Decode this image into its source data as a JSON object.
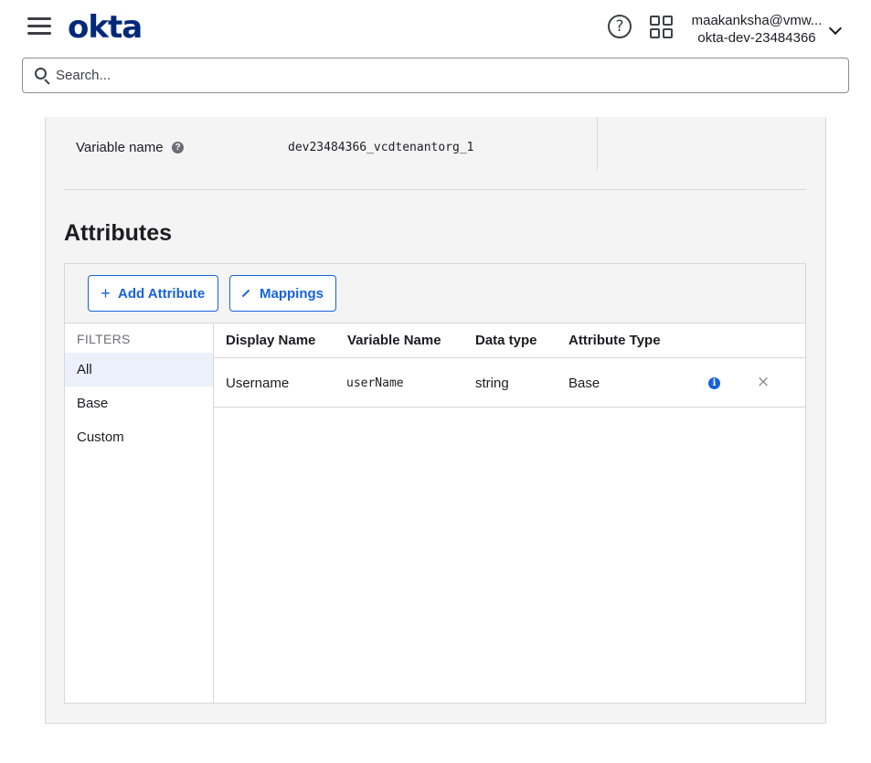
{
  "header": {
    "logo_text": "okta",
    "help_icon": "?",
    "user_email": "maakanksha@vmw...",
    "user_org": "okta-dev-23484366"
  },
  "search": {
    "placeholder": "Search..."
  },
  "variable": {
    "label": "Variable name",
    "help_icon": "?",
    "value": "dev23484366_vcdtenantorg_1"
  },
  "attributes": {
    "title": "Attributes",
    "add_button": "Add Attribute",
    "add_icon": "+",
    "mappings_button": "Mappings",
    "filters_title": "FILTERS",
    "filters": [
      "All",
      "Base",
      "Custom"
    ],
    "columns": [
      "Display Name",
      "Variable Name",
      "Data type",
      "Attribute Type"
    ],
    "rows": [
      {
        "display_name": "Username",
        "variable_name": "userName",
        "data_type": "string",
        "attribute_type": "Base",
        "info_icon": "i",
        "remove_icon": "×"
      }
    ]
  },
  "colors": {
    "brand": "#00297a",
    "accent": "#1662dd",
    "panel_bg": "#f4f4f4",
    "active_filter_bg": "#ebf0fa"
  }
}
